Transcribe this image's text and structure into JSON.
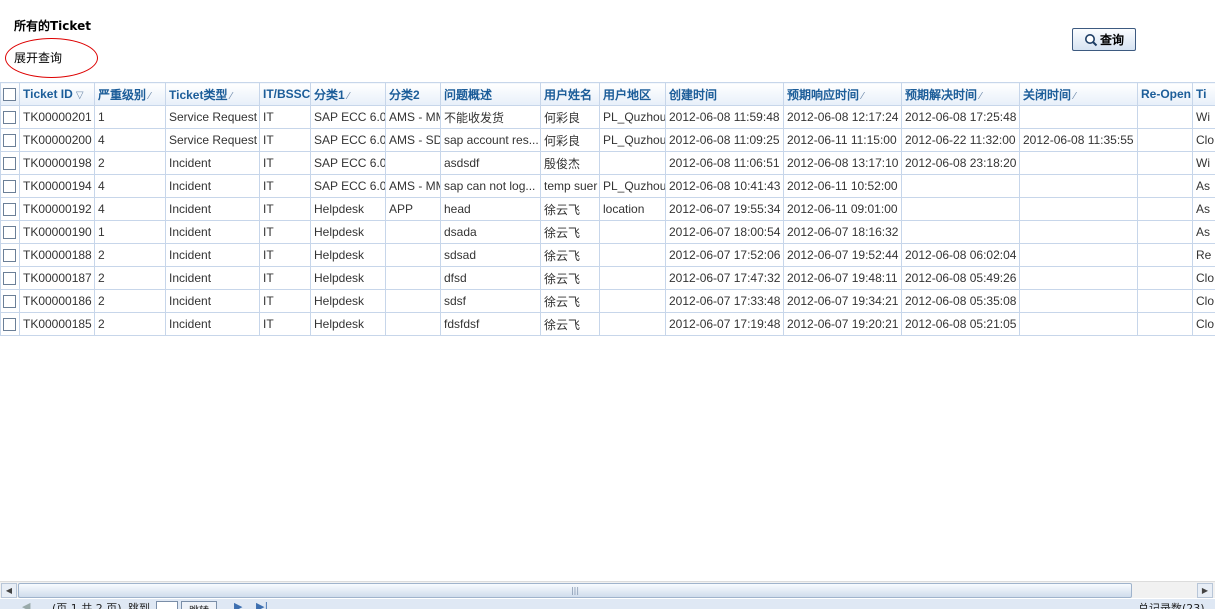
{
  "page": {
    "title": "所有的Ticket",
    "expand_query_label": "展开查询",
    "query_button_label": "查询"
  },
  "table": {
    "columns": [
      {
        "label": "Ticket ID",
        "sort": "▽"
      },
      {
        "label": "严重级别",
        "sort": "⁄"
      },
      {
        "label": "Ticket类型",
        "sort": "⁄"
      },
      {
        "label": "IT/BSSC",
        "sort": ""
      },
      {
        "label": "分类1",
        "sort": "⁄"
      },
      {
        "label": "分类2",
        "sort": ""
      },
      {
        "label": "问题概述",
        "sort": ""
      },
      {
        "label": "用户姓名",
        "sort": ""
      },
      {
        "label": "用户地区",
        "sort": ""
      },
      {
        "label": "创建时间",
        "sort": ""
      },
      {
        "label": "预期响应时间",
        "sort": "⁄"
      },
      {
        "label": "预期解决时间",
        "sort": "⁄"
      },
      {
        "label": "关闭时间",
        "sort": "⁄"
      },
      {
        "label": "Re-Open",
        "sort": ""
      },
      {
        "label": "Ti",
        "sort": ""
      }
    ],
    "rows": [
      [
        "TK00000201",
        "1",
        "Service Request",
        "IT",
        "SAP ECC 6.0",
        "AMS - MM",
        "不能收发货",
        "何彩良",
        "PL_Quzhou",
        "2012-06-08 11:59:48",
        "2012-06-08 12:17:24",
        "2012-06-08 17:25:48",
        "",
        "",
        "Wi"
      ],
      [
        "TK00000200",
        "4",
        "Service Request",
        "IT",
        "SAP ECC 6.0",
        "AMS - SD",
        "sap account res...",
        "何彩良",
        "PL_Quzhou",
        "2012-06-08 11:09:25",
        "2012-06-11 11:15:00",
        "2012-06-22 11:32:00",
        "2012-06-08 11:35:55",
        "",
        "Clo"
      ],
      [
        "TK00000198",
        "2",
        "Incident",
        "IT",
        "SAP ECC 6.0",
        "",
        "asdsdf",
        "殷俊杰",
        "",
        "2012-06-08 11:06:51",
        "2012-06-08 13:17:10",
        "2012-06-08 23:18:20",
        "",
        "",
        "Wi"
      ],
      [
        "TK00000194",
        "4",
        "Incident",
        "IT",
        "SAP ECC 6.0",
        "AMS - MM",
        "sap can not log...",
        "temp suer",
        "PL_Quzhou",
        "2012-06-08 10:41:43",
        "2012-06-11 10:52:00",
        "",
        "",
        "",
        "As"
      ],
      [
        "TK00000192",
        "4",
        "Incident",
        "IT",
        "Helpdesk",
        "APP",
        "head",
        "徐云飞",
        "location",
        "2012-06-07 19:55:34",
        "2012-06-11 09:01:00",
        "",
        "",
        "",
        "As"
      ],
      [
        "TK00000190",
        "1",
        "Incident",
        "IT",
        "Helpdesk",
        "",
        "dsada",
        "徐云飞",
        "",
        "2012-06-07 18:00:54",
        "2012-06-07 18:16:32",
        "",
        "",
        "",
        "As"
      ],
      [
        "TK00000188",
        "2",
        "Incident",
        "IT",
        "Helpdesk",
        "",
        "sdsad",
        "徐云飞",
        "",
        "2012-06-07 17:52:06",
        "2012-06-07 19:52:44",
        "2012-06-08 06:02:04",
        "",
        "",
        "Re"
      ],
      [
        "TK00000187",
        "2",
        "Incident",
        "IT",
        "Helpdesk",
        "",
        "dfsd",
        "徐云飞",
        "",
        "2012-06-07 17:47:32",
        "2012-06-07 19:48:11",
        "2012-06-08 05:49:26",
        "",
        "",
        "Clo"
      ],
      [
        "TK00000186",
        "2",
        "Incident",
        "IT",
        "Helpdesk",
        "",
        "sdsf",
        "徐云飞",
        "",
        "2012-06-07 17:33:48",
        "2012-06-07 19:34:21",
        "2012-06-08 05:35:08",
        "",
        "",
        "Clo"
      ],
      [
        "TK00000185",
        "2",
        "Incident",
        "IT",
        "Helpdesk",
        "",
        "fdsfdsf",
        "徐云飞",
        "",
        "2012-06-07 17:19:48",
        "2012-06-07 19:20:21",
        "2012-06-08 05:21:05",
        "",
        "",
        "Clo"
      ]
    ]
  },
  "icons": {
    "query_button": "magnifier-icon",
    "scroll_left": "arrow-left-icon",
    "scroll_right": "arrow-right-icon"
  },
  "colors": {
    "header_text": "#1c5d99",
    "expand_circle": "#dd0000",
    "grid_border": "#c7d6ea"
  },
  "pager": {
    "page_info": "(页 1 共 2 页)",
    "jump_label": "跳到",
    "go_label": "跳转",
    "total": "总记录数(23)"
  }
}
